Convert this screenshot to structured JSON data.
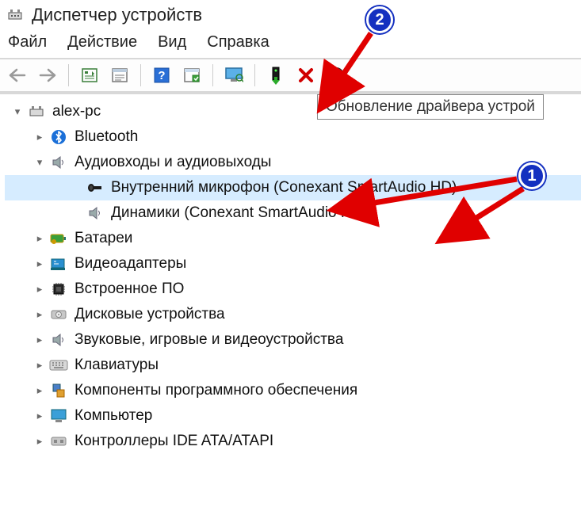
{
  "window": {
    "title": "Диспетчер устройств"
  },
  "menu": {
    "file": "Файл",
    "action": "Действие",
    "view": "Вид",
    "help": "Справка"
  },
  "toolbar": {
    "tooltip": "Обновление драйвера устрой"
  },
  "tree": {
    "root": "alex-pc",
    "bluetooth": "Bluetooth",
    "audio": "Аудиовходы и аудиовыходы",
    "mic": "Внутренний микрофон (Conexant SmartAudio HD)",
    "speakers": "Динамики (Conexant SmartAudio HD)",
    "batteries": "Батареи",
    "video_adapters": "Видеоадаптеры",
    "firmware": "Встроенное ПО",
    "disk": "Дисковые устройства",
    "sound_game": "Звуковые, игровые и видеоустройства",
    "keyboards": "Клавиатуры",
    "software_components": "Компоненты программного обеспечения",
    "computer": "Компьютер",
    "ide": "Контроллеры IDE ATA/ATAPI"
  },
  "annotations": {
    "badge1": "1",
    "badge2": "2"
  }
}
